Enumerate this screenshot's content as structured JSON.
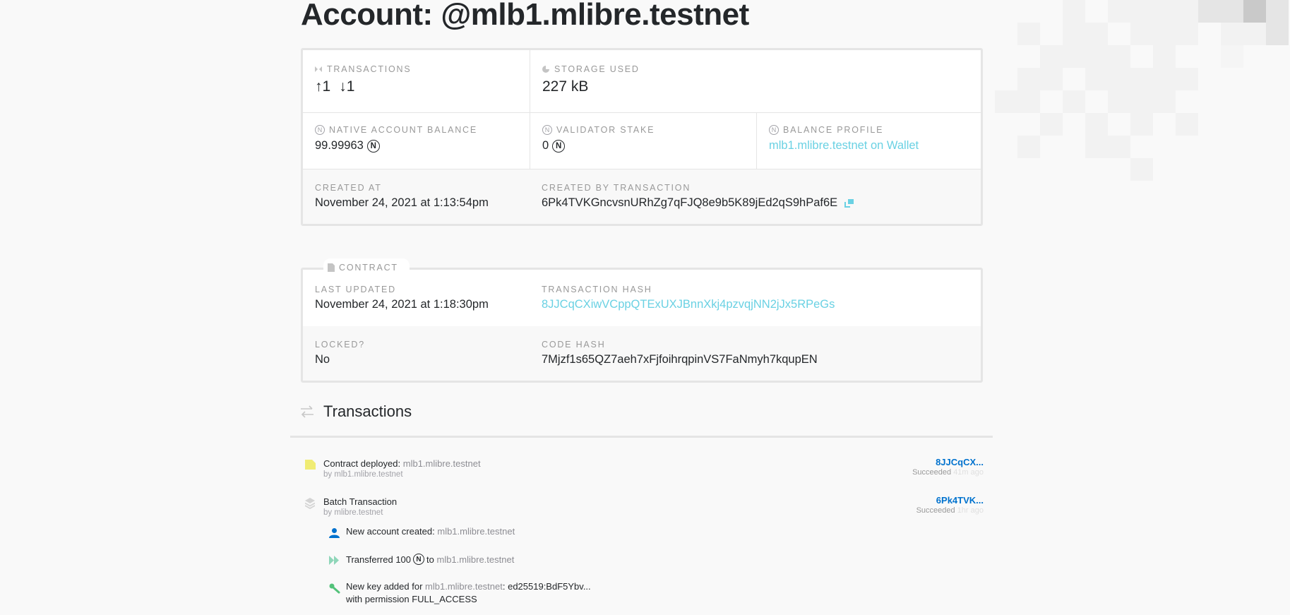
{
  "page": {
    "title": "Account: @mlb1.mlibre.testnet"
  },
  "account": {
    "transactions": {
      "label": "Transactions",
      "icon": "transactions-icon",
      "outgoing": "1",
      "incoming": "1",
      "outgoing_arrow": "↑",
      "incoming_arrow": "↓"
    },
    "storage": {
      "label": "Storage Used",
      "icon": "pie-chart-icon",
      "value": "227 kB"
    },
    "native_balance": {
      "label": "Native Account Balance",
      "icon": "near-icon",
      "value": "99.99963",
      "unit": "N"
    },
    "validator_stake": {
      "label": "Validator Stake",
      "icon": "near-icon",
      "value": "0",
      "unit": "N"
    },
    "balance_profile": {
      "label": "Balance Profile",
      "icon": "near-icon",
      "link": "mlb1.mlibre.testnet on Wallet"
    },
    "created_at": {
      "label": "Created At",
      "value": "November 24, 2021 at 1:13:54pm"
    },
    "created_by": {
      "label": "Created By Transaction",
      "value": "6Pk4TVKGncvsnURhZg7qFJQ8e9b5K89jEd2qS9hPaf6E",
      "copy_icon": "copy-icon"
    }
  },
  "contract": {
    "tab_label": "Contract",
    "last_updated": {
      "label": "Last Updated",
      "value": "November 24, 2021 at 1:18:30pm"
    },
    "transaction_hash": {
      "label": "Transaction Hash",
      "value": "8JJCqCXiwVCppQTExUXJBnnXkj4pzvqjNN2jJx5RPeGs"
    },
    "locked": {
      "label": "Locked?",
      "value": "No"
    },
    "code_hash": {
      "label": "Code Hash",
      "value": "7Mjzf1s65QZ7aeh7xFjfoihrqpinVS7FaNmyh7kqupEN"
    }
  },
  "transactions_section": {
    "title": "Transactions",
    "items": [
      {
        "type": "Contract deployed",
        "target": "mlb1.mlibre.testnet",
        "by_prefix": "by",
        "by": "mlb1.mlibre.testnet",
        "hash": "8JJCqCX...",
        "status": "Succeeded",
        "ago": "41m ago"
      },
      {
        "type": "Batch Transaction",
        "by_prefix": "by",
        "by": "mlibre.testnet",
        "hash": "6Pk4TVK...",
        "status": "Succeeded",
        "ago": "1hr ago",
        "actions": [
          {
            "text": "New account created:",
            "target": "mlb1.mlibre.testnet"
          },
          {
            "text": "Transferred 100",
            "unit": "N",
            "to": "to",
            "target": "mlb1.mlibre.testnet"
          },
          {
            "text": "New key added for",
            "target": "mlb1.mlibre.testnet",
            "suffix": ": ed25519:BdF5Ybv...",
            "line2": "with permission FULL_ACCESS"
          }
        ]
      }
    ]
  },
  "colors": {
    "link": "#6ad1e3",
    "hash_link": "#0072ce",
    "text": "#24272a",
    "muted": "#999999",
    "border": "#e5e5e5"
  }
}
